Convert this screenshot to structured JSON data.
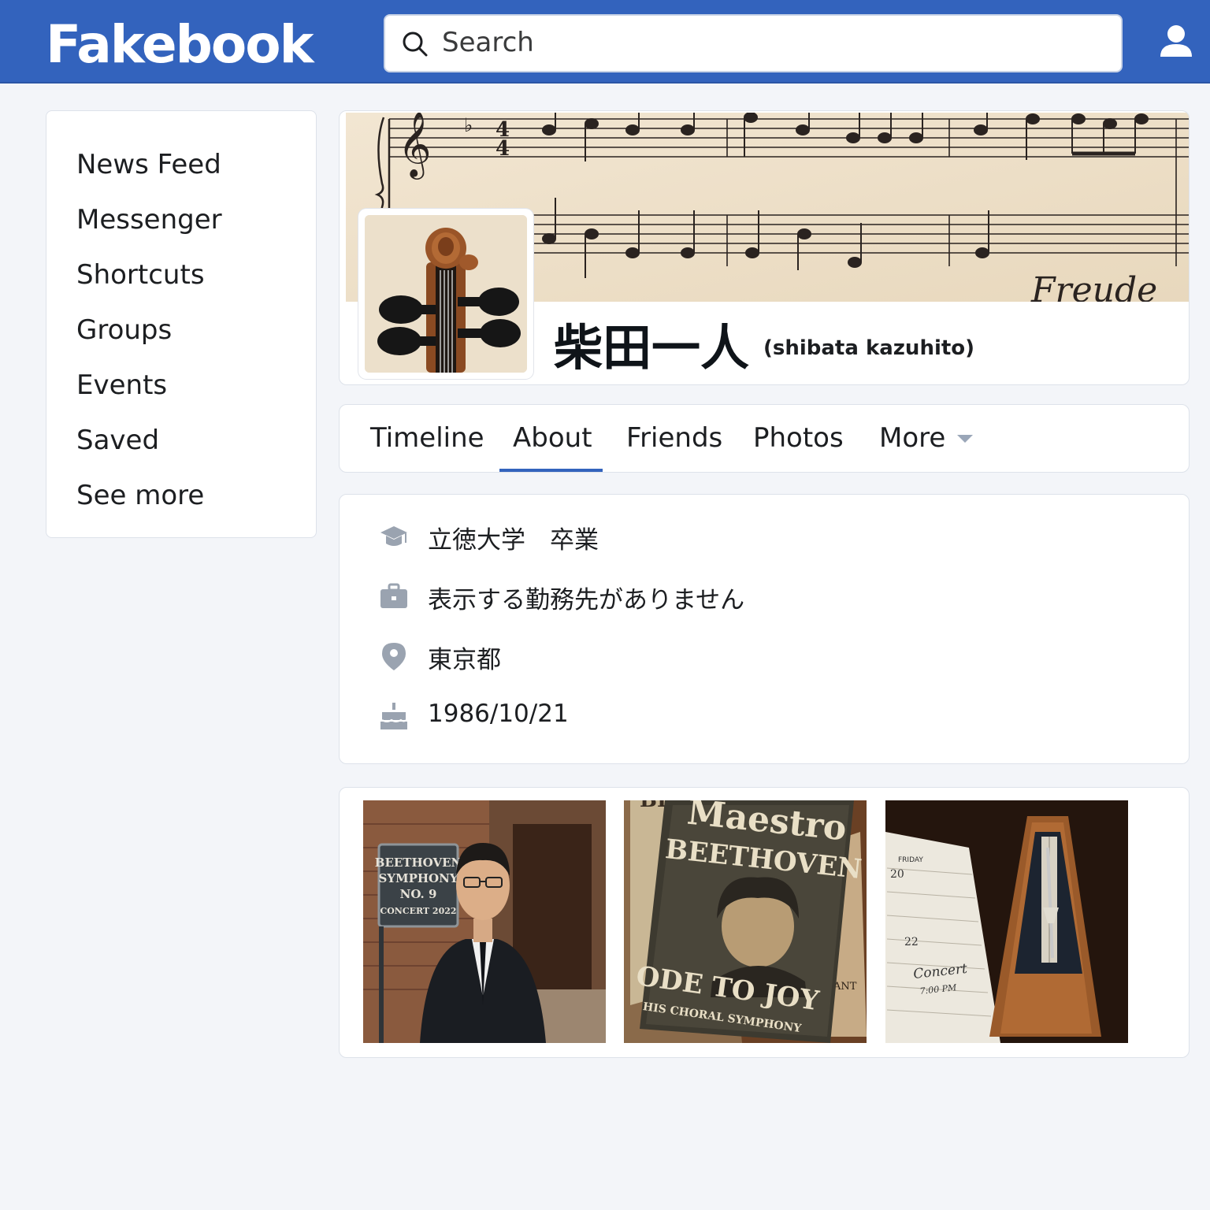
{
  "header": {
    "logo": "Fakebook",
    "search": {
      "placeholder": "Search"
    }
  },
  "sidebar": {
    "items": [
      {
        "label": "News Feed"
      },
      {
        "label": "Messenger"
      },
      {
        "label": "Shortcuts"
      },
      {
        "label": "Groups"
      },
      {
        "label": "Events"
      },
      {
        "label": "Saved"
      },
      {
        "label": "See more"
      }
    ]
  },
  "profile": {
    "name": "柴田一人",
    "romaji": "(shibata kazuhito)",
    "cover_script_text": "Freude"
  },
  "tabs": [
    {
      "label": "Timeline"
    },
    {
      "label": "About",
      "active": true
    },
    {
      "label": "Friends"
    },
    {
      "label": "Photos"
    },
    {
      "label": "More"
    }
  ],
  "about": [
    {
      "icon": "graduation-cap-icon",
      "text": "立徳大学　卒業"
    },
    {
      "icon": "briefcase-icon",
      "text": "表示する勤務先がありません"
    },
    {
      "icon": "location-pin-icon",
      "text": "東京都"
    },
    {
      "icon": "birthday-cake-icon",
      "text": "1986/10/21"
    }
  ],
  "photos": {
    "photo1": {
      "sign_lines": [
        "BEETHOVEN",
        "SYMPHONY",
        "NO. 9",
        "CONCERT 2022"
      ]
    },
    "photo2": {
      "book_title_top": "Maestro",
      "book_title_main": "BEETHOVEN",
      "book_subtitle": "ODE TO JOY",
      "book_tagline": "HIS CHORAL SYMPHONY",
      "back_book_top": "BE",
      "back_book_side": "ANT"
    },
    "photo3": {
      "day_label": "FRIDAY",
      "date_1": "20",
      "date_2": "22",
      "entry": "Concert",
      "time": "7:00 PM"
    }
  },
  "colors": {
    "brand_blue": "#3363bd",
    "page_bg": "#f3f5f9",
    "card_border": "#dde2ea",
    "icon_gray": "#9aa3b0"
  }
}
